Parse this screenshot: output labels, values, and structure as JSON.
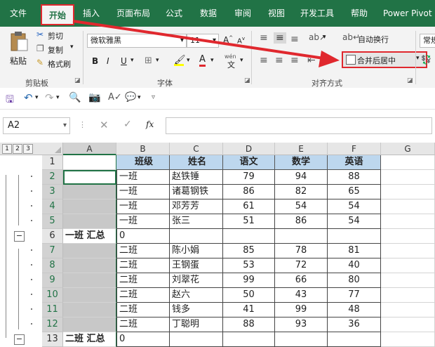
{
  "tabs": [
    "文件",
    "开始",
    "插入",
    "页面布局",
    "公式",
    "数据",
    "审阅",
    "视图",
    "开发工具",
    "帮助",
    "Power Pivot"
  ],
  "clipboard": {
    "paste": "粘贴",
    "cut": "剪切",
    "copy": "复制",
    "format_painter": "格式刷",
    "group": "剪贴板"
  },
  "font": {
    "name": "微软雅黑",
    "size": "11",
    "bold": "B",
    "italic": "I",
    "underline": "U",
    "group": "字体",
    "font_color_letter": "A",
    "phonetic": "wén"
  },
  "alignment": {
    "wrap": "自动换行",
    "merge": "合并后居中",
    "group": "对齐方式"
  },
  "number": {
    "format_partial": "常规"
  },
  "namebox": "A2",
  "fx": "fx",
  "outline_levels": [
    "1",
    "2",
    "3"
  ],
  "columns": [
    "A",
    "B",
    "C",
    "D",
    "E",
    "F",
    "G"
  ],
  "rows": [
    {
      "num": "1",
      "a": "",
      "b": "班级",
      "c": "姓名",
      "d": "语文",
      "e": "数学",
      "f": "英语",
      "header": true
    },
    {
      "num": "2",
      "a": "",
      "b": "一班",
      "c": "赵铁锤",
      "d": "79",
      "e": "94",
      "f": "88"
    },
    {
      "num": "3",
      "a": "",
      "b": "一班",
      "c": "诸葛钢铁",
      "d": "86",
      "e": "82",
      "f": "65"
    },
    {
      "num": "4",
      "a": "",
      "b": "一班",
      "c": "邓芳芳",
      "d": "61",
      "e": "54",
      "f": "54"
    },
    {
      "num": "5",
      "a": "",
      "b": "一班",
      "c": "张三",
      "d": "51",
      "e": "86",
      "f": "54"
    },
    {
      "num": "6",
      "a": "一班 汇总",
      "b": "0",
      "c": "",
      "d": "",
      "e": "",
      "f": "",
      "summary": true
    },
    {
      "num": "7",
      "a": "",
      "b": "二班",
      "c": "陈小娟",
      "d": "85",
      "e": "78",
      "f": "81"
    },
    {
      "num": "8",
      "a": "",
      "b": "二班",
      "c": "王钢蛋",
      "d": "53",
      "e": "72",
      "f": "40"
    },
    {
      "num": "9",
      "a": "",
      "b": "二班",
      "c": "刘翠花",
      "d": "99",
      "e": "66",
      "f": "80"
    },
    {
      "num": "10",
      "a": "",
      "b": "二班",
      "c": "赵六",
      "d": "50",
      "e": "43",
      "f": "77"
    },
    {
      "num": "11",
      "a": "",
      "b": "二班",
      "c": "钱多",
      "d": "41",
      "e": "99",
      "f": "48"
    },
    {
      "num": "12",
      "a": "",
      "b": "二班",
      "c": "丁聪明",
      "d": "88",
      "e": "93",
      "f": "36"
    },
    {
      "num": "13",
      "a": "二班 汇总",
      "b": "0",
      "c": "",
      "d": "",
      "e": "",
      "f": "",
      "summary": true
    }
  ],
  "colors": {
    "ribbon_green": "#217346",
    "header_fill": "#bdd7ee",
    "selection_gray": "#c8c8c8",
    "highlight_red": "#e0282e"
  }
}
